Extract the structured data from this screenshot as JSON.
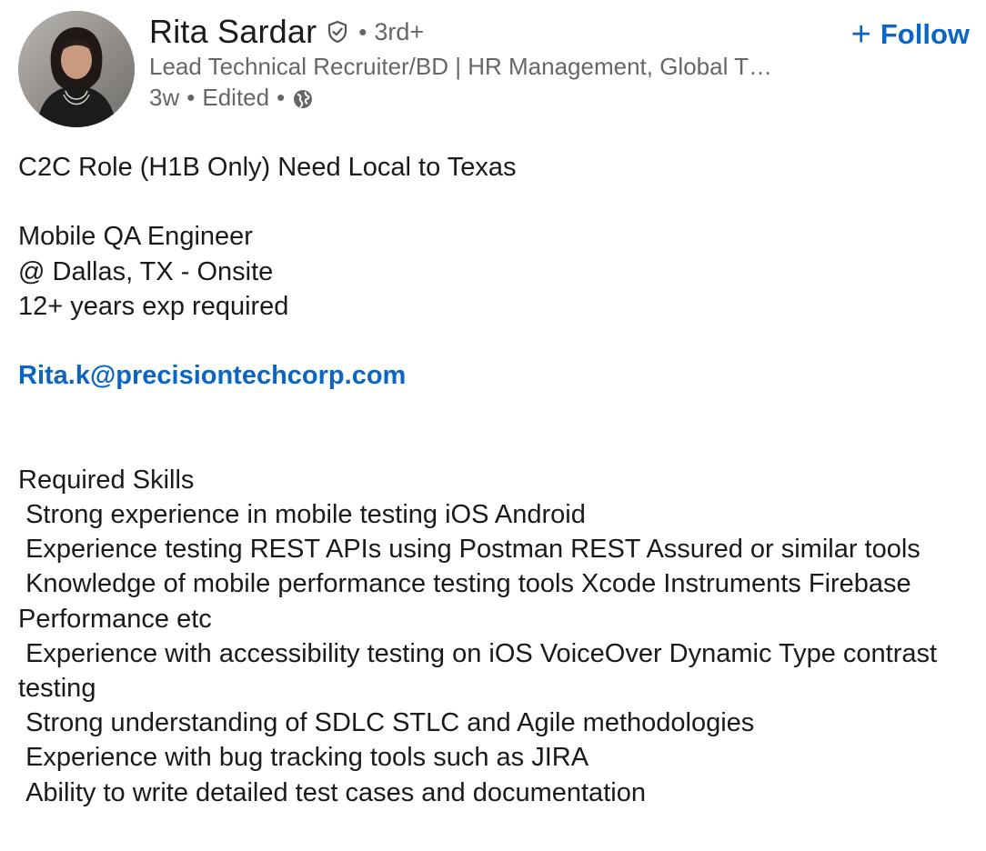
{
  "author": {
    "name": "Rita Sardar",
    "degree": "3rd+",
    "headline": "Lead Technical Recruiter/BD | HR Management, Global T…",
    "age": "3w",
    "edited": "Edited",
    "visibility_icon": "globe-icon",
    "verified_icon": "shield-check-icon"
  },
  "follow": {
    "plus": "+",
    "label": "Follow"
  },
  "post": {
    "line1": "C2C Role (H1B Only) Need Local to Texas",
    "role": "Mobile QA Engineer",
    "location": "@ Dallas, TX - Onsite",
    "experience": "12+ years exp required",
    "email": "Rita.k@precisiontechcorp.com",
    "skills_heading": "Required Skills",
    "skills": [
      " Strong experience in mobile testing iOS Android",
      " Experience testing REST APIs using Postman REST Assured or similar tools",
      " Knowledge of mobile performance testing tools Xcode Instruments Firebase Performance etc",
      " Experience with accessibility testing on iOS VoiceOver Dynamic Type contrast testing",
      " Strong understanding of SDLC STLC and Agile methodologies",
      " Experience with bug tracking tools such as JIRA",
      " Ability to write detailed test cases and documentation"
    ]
  },
  "colors": {
    "link": "#0a66c2",
    "secondary_text": "#666666",
    "primary_text": "#1a1a1a"
  }
}
